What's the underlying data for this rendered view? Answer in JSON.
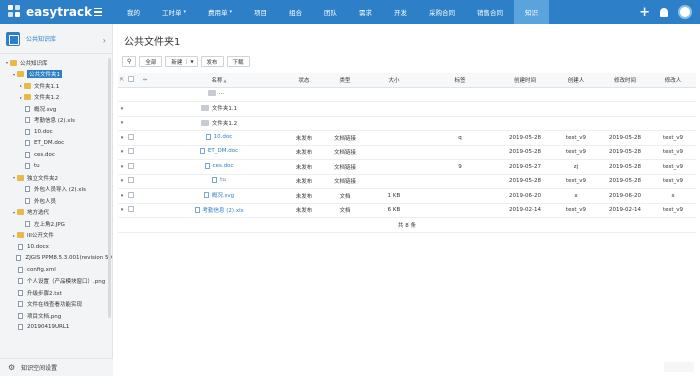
{
  "app": {
    "brand": "easytrack"
  },
  "nav": {
    "items": [
      {
        "label": "我的",
        "dropdown": false
      },
      {
        "label": "工时单",
        "dropdown": true
      },
      {
        "label": "费用单",
        "dropdown": true
      },
      {
        "label": "项目",
        "dropdown": false
      },
      {
        "label": "组合",
        "dropdown": false
      },
      {
        "label": "团队",
        "dropdown": false
      },
      {
        "label": "需求",
        "dropdown": false
      },
      {
        "label": "开发",
        "dropdown": false
      },
      {
        "label": "采购合同",
        "dropdown": false
      },
      {
        "label": "销售合同",
        "dropdown": false
      },
      {
        "label": "知识",
        "dropdown": false
      }
    ],
    "plus_glyph": "+",
    "accent": "#2d7fc8",
    "active_bg": "#5aa3dd"
  },
  "sidebar": {
    "title": "公共知识库",
    "tree": [
      {
        "label": "公共知识库",
        "kind": "folder",
        "expanded": true,
        "level": 0
      },
      {
        "label": "公共文件夹1",
        "kind": "folder",
        "expanded": true,
        "level": 1,
        "selected": true
      },
      {
        "label": "文件夹1.1",
        "kind": "folder",
        "level": 2
      },
      {
        "label": "文件夹1.2",
        "kind": "folder",
        "level": 2
      },
      {
        "label": "概况.svg",
        "kind": "file",
        "level": 2
      },
      {
        "label": "考勤信息 (2).xls",
        "kind": "file",
        "level": 2
      },
      {
        "label": "10.doc",
        "kind": "file",
        "level": 2
      },
      {
        "label": "ET_DM.doc",
        "kind": "file",
        "level": 2
      },
      {
        "label": "ces.doc",
        "kind": "file",
        "level": 2
      },
      {
        "label": "tu",
        "kind": "file",
        "level": 2
      },
      {
        "label": "独立文件夹2",
        "kind": "folder",
        "expanded": true,
        "level": 1
      },
      {
        "label": "外包人员导入 (2).xls",
        "kind": "file",
        "level": 2
      },
      {
        "label": "外包人员",
        "kind": "file",
        "level": 2
      },
      {
        "label": "地方选代",
        "kind": "folder",
        "expanded": true,
        "level": 1
      },
      {
        "label": "左上角2.JPG",
        "kind": "file",
        "level": 2
      },
      {
        "label": "III公开文件",
        "kind": "folder",
        "expanded": false,
        "level": 1
      },
      {
        "label": "10.docx",
        "kind": "file",
        "level": 1
      },
      {
        "label": "ZJGIS PPM8.5.3.001(revision 59",
        "kind": "file",
        "level": 1
      },
      {
        "label": "config.xml",
        "kind": "file",
        "level": 1
      },
      {
        "label": "个人设置（产品模块窗口）.png",
        "kind": "file",
        "level": 1
      },
      {
        "label": "升级步骤2.txt",
        "kind": "file",
        "level": 1
      },
      {
        "label": "文件在线查看功能实现",
        "kind": "file",
        "level": 1
      },
      {
        "label": "项目文档.png",
        "kind": "file",
        "level": 1
      },
      {
        "label": "20190419URL1",
        "kind": "file",
        "level": 1
      }
    ],
    "footer": "知识空间设置"
  },
  "main": {
    "title": "公共文件夹1",
    "toolbar": {
      "all": "全部",
      "new": "新建",
      "publish": "发布",
      "download": "下载"
    },
    "columns": {
      "name": "名称",
      "status": "状态",
      "type": "类型",
      "size": "大小",
      "tags": "标签",
      "created": "创建时间",
      "creator": "创建人",
      "modified": "修改时间",
      "modifier": "修改人"
    },
    "rows": [
      {
        "kind": "up",
        "name": "...",
        "status": "",
        "type": "",
        "size": "",
        "tags": "",
        "created": "",
        "creator": "",
        "modified": "",
        "modifier": ""
      },
      {
        "kind": "folder",
        "name": "文件夹1.1",
        "status": "",
        "type": "",
        "size": "",
        "tags": "",
        "created": "",
        "creator": "",
        "modified": "",
        "modifier": ""
      },
      {
        "kind": "folder",
        "name": "文件夹1.2",
        "status": "",
        "type": "",
        "size": "",
        "tags": "",
        "created": "",
        "creator": "",
        "modified": "",
        "modifier": ""
      },
      {
        "kind": "file",
        "name": "10.doc",
        "status": "未发布",
        "type": "文档链接",
        "size": "",
        "tags": "q",
        "created": "2019-05-28",
        "creator": "test_v9",
        "modified": "2019-05-28",
        "modifier": "test_v9"
      },
      {
        "kind": "file",
        "name": "ET_DM.doc",
        "status": "未发布",
        "type": "文档链接",
        "size": "",
        "tags": "",
        "created": "2019-05-28",
        "creator": "test_v9",
        "modified": "2019-05-28",
        "modifier": "test_v9"
      },
      {
        "kind": "file",
        "name": "ces.doc",
        "status": "未发布",
        "type": "文档链接",
        "size": "",
        "tags": "9",
        "created": "2019-05-27",
        "creator": "zj",
        "modified": "2019-05-28",
        "modifier": "test_v9"
      },
      {
        "kind": "file",
        "name": "tu",
        "status": "未发布",
        "type": "文档链接",
        "size": "",
        "tags": "",
        "created": "2019-05-28",
        "creator": "test_v9",
        "modified": "2019-05-28",
        "modifier": "test_v9"
      },
      {
        "kind": "file",
        "name": "概况.svg",
        "status": "未发布",
        "type": "文档",
        "size": "1 KB",
        "tags": "",
        "created": "2019-06-20",
        "creator": "x",
        "modified": "2019-06-20",
        "modifier": "x"
      },
      {
        "kind": "file",
        "name": "考勤信息 (2).xls",
        "status": "未发布",
        "type": "文档",
        "size": "6 KB",
        "tags": "",
        "created": "2019-02-14",
        "creator": "test_v9",
        "modified": "2019-02-14",
        "modifier": "test_v9"
      }
    ],
    "footer": "共 8 条"
  }
}
